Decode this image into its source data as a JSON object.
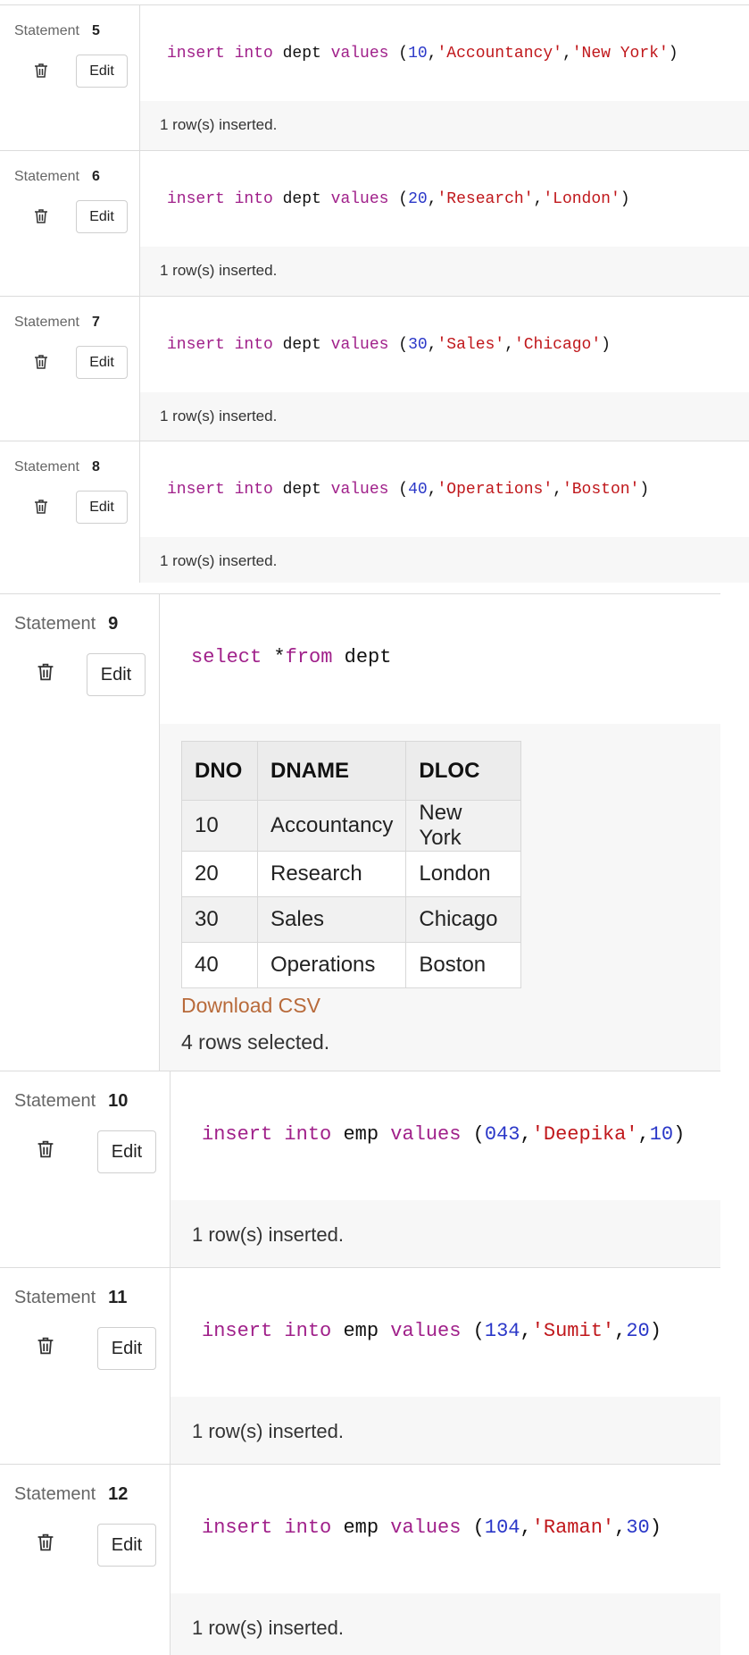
{
  "statement_label": "Statement",
  "edit_label": "Edit",
  "statements": [
    {
      "number": "5",
      "code": [
        [
          "kw",
          "insert into "
        ],
        [
          "id",
          "dept "
        ],
        [
          "kw",
          "values "
        ],
        [
          "id",
          "("
        ],
        [
          "num",
          "10"
        ],
        [
          "id",
          ","
        ],
        [
          "str",
          "'Accountancy'"
        ],
        [
          "id",
          ","
        ],
        [
          "str",
          "'New York'"
        ],
        [
          "id",
          ")"
        ]
      ],
      "result": "1 row(s) inserted."
    },
    {
      "number": "6",
      "code": [
        [
          "kw",
          "insert into "
        ],
        [
          "id",
          "dept "
        ],
        [
          "kw",
          "values "
        ],
        [
          "id",
          "("
        ],
        [
          "num",
          "20"
        ],
        [
          "id",
          ","
        ],
        [
          "str",
          "'Research'"
        ],
        [
          "id",
          ","
        ],
        [
          "str",
          "'London'"
        ],
        [
          "id",
          ")"
        ]
      ],
      "result": "1 row(s) inserted."
    },
    {
      "number": "7",
      "code": [
        [
          "kw",
          "insert into "
        ],
        [
          "id",
          "dept "
        ],
        [
          "kw",
          "values "
        ],
        [
          "id",
          "("
        ],
        [
          "num",
          "30"
        ],
        [
          "id",
          ","
        ],
        [
          "str",
          "'Sales'"
        ],
        [
          "id",
          ","
        ],
        [
          "str",
          "'Chicago'"
        ],
        [
          "id",
          ")"
        ]
      ],
      "result": "1 row(s) inserted."
    },
    {
      "number": "8",
      "code": [
        [
          "kw",
          "insert into "
        ],
        [
          "id",
          "dept "
        ],
        [
          "kw",
          "values "
        ],
        [
          "id",
          "("
        ],
        [
          "num",
          "40"
        ],
        [
          "id",
          ","
        ],
        [
          "str",
          "'Operations'"
        ],
        [
          "id",
          ","
        ],
        [
          "str",
          "'Boston'"
        ],
        [
          "id",
          ")"
        ]
      ],
      "result": "1 row(s) inserted."
    },
    {
      "number": "9",
      "code": [
        [
          "kw",
          "select "
        ],
        [
          "id",
          "*"
        ],
        [
          "kw",
          "from "
        ],
        [
          "id",
          "dept"
        ]
      ],
      "table": {
        "headers": [
          "DNO",
          "DNAME",
          "DLOC"
        ],
        "rows": [
          [
            "10",
            "Accountancy",
            "New York"
          ],
          [
            "20",
            "Research",
            "London"
          ],
          [
            "30",
            "Sales",
            "Chicago"
          ],
          [
            "40",
            "Operations",
            "Boston"
          ]
        ]
      },
      "download": "Download CSV",
      "result": "4 rows selected."
    },
    {
      "number": "10",
      "code": [
        [
          "kw",
          "insert into "
        ],
        [
          "id",
          "emp "
        ],
        [
          "kw",
          "values "
        ],
        [
          "id",
          "("
        ],
        [
          "num",
          "043"
        ],
        [
          "id",
          ","
        ],
        [
          "str",
          "'Deepika'"
        ],
        [
          "id",
          ","
        ],
        [
          "num",
          "10"
        ],
        [
          "id",
          ")"
        ]
      ],
      "result": "1 row(s) inserted."
    },
    {
      "number": "11",
      "code": [
        [
          "kw",
          "insert into "
        ],
        [
          "id",
          "emp "
        ],
        [
          "kw",
          "values "
        ],
        [
          "id",
          "("
        ],
        [
          "num",
          "134"
        ],
        [
          "id",
          ","
        ],
        [
          "str",
          "'Sumit'"
        ],
        [
          "id",
          ","
        ],
        [
          "num",
          "20"
        ],
        [
          "id",
          ")"
        ]
      ],
      "result": "1 row(s) inserted."
    },
    {
      "number": "12",
      "code": [
        [
          "kw",
          "insert into "
        ],
        [
          "id",
          "emp "
        ],
        [
          "kw",
          "values "
        ],
        [
          "id",
          "("
        ],
        [
          "num",
          "104"
        ],
        [
          "id",
          ","
        ],
        [
          "str",
          "'Raman'"
        ],
        [
          "id",
          ","
        ],
        [
          "num",
          "30"
        ],
        [
          "id",
          ")"
        ]
      ],
      "result": "1 row(s) inserted."
    }
  ]
}
